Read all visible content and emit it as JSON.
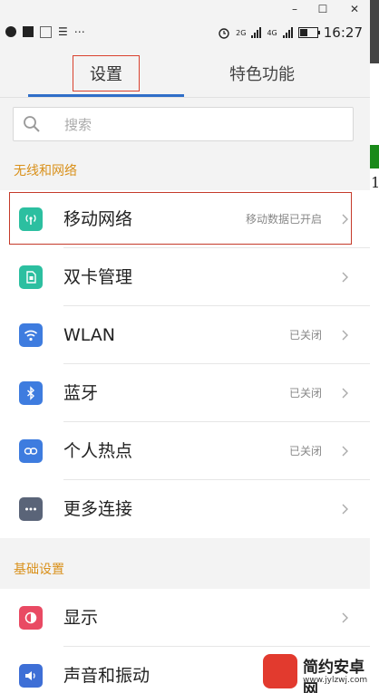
{
  "window": {
    "minimize": "–",
    "maximize": "☐",
    "close": "✕"
  },
  "statusbar": {
    "time": "16:27",
    "net1": "2G",
    "net2": "4G",
    "doc": "⋯",
    "left_doc_icon": "☰"
  },
  "tabs": [
    {
      "label": "设置",
      "active": true
    },
    {
      "label": "特色功能",
      "active": false
    }
  ],
  "search": {
    "placeholder": "搜索"
  },
  "sections": {
    "wireless": "无线和网络",
    "basic": "基础设置"
  },
  "wireless_items": [
    {
      "label": "移动网络",
      "status": "移动数据已开启",
      "icon": "antenna-icon",
      "color": "#2cbfa0"
    },
    {
      "label": "双卡管理",
      "status": "",
      "icon": "sim-card-icon",
      "color": "#2cbfa0"
    },
    {
      "label": "WLAN",
      "status": "已关闭",
      "icon": "wifi-icon",
      "color": "#3e7cdf"
    },
    {
      "label": "蓝牙",
      "status": "已关闭",
      "icon": "bluetooth-icon",
      "color": "#3e7cdf"
    },
    {
      "label": "个人热点",
      "status": "已关闭",
      "icon": "hotspot-icon",
      "color": "#3e7cdf"
    },
    {
      "label": "更多连接",
      "status": "",
      "icon": "more-icon",
      "color": "#5a6478"
    }
  ],
  "basic_items": [
    {
      "label": "显示",
      "status": "",
      "icon": "display-icon",
      "color": "#e94a63"
    },
    {
      "label": "声音和振动",
      "status": "",
      "icon": "sound-icon",
      "color": "#3e6fd6"
    }
  ],
  "watermark": {
    "title": "简约安卓网",
    "url": "www.jylzwj.com"
  },
  "side_digit": "1"
}
